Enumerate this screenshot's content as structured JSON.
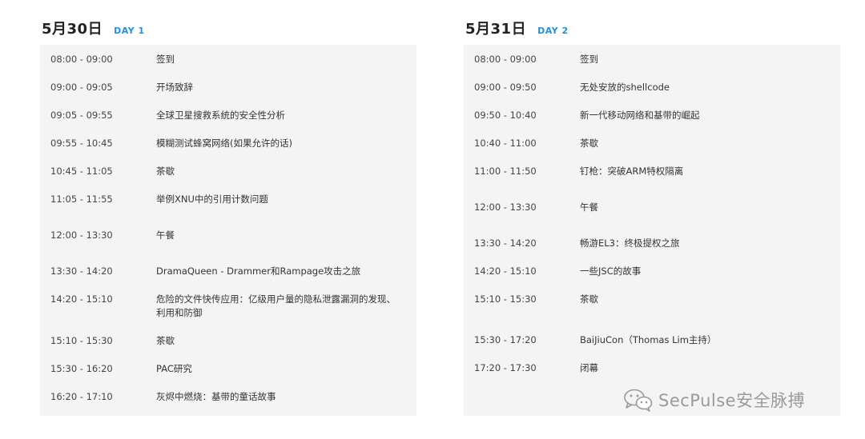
{
  "day1": {
    "date": "5月30日",
    "tag": "DAY 1",
    "rows": [
      {
        "time": "08:00 - 09:00",
        "title": "签到"
      },
      {
        "time": "09:00 - 09:05",
        "title": "开场致辞"
      },
      {
        "time": "09:05 - 09:55",
        "title": "全球卫星搜救系统的安全性分析"
      },
      {
        "time": "09:55 - 10:45",
        "title": "模糊测试蜂窝网络(如果允许的话)"
      },
      {
        "time": "10:45 - 11:05",
        "title": "茶歇"
      },
      {
        "time": "11:05 - 11:55",
        "title": "举例XNU中的引用计数问题"
      },
      {
        "time": "12:00 - 13:30",
        "title": "午餐"
      },
      {
        "time": "13:30 - 14:20",
        "title": "DramaQueen - Drammer和Rampage攻击之旅"
      },
      {
        "time": "14:20 - 15:10",
        "title": "危险的文件快传应用：亿级用户量的隐私泄露漏洞的发现、利用和防御"
      },
      {
        "time": "15:10 - 15:30",
        "title": "茶歇"
      },
      {
        "time": "15:30 - 16:20",
        "title": "PAC研究"
      },
      {
        "time": "16:20 - 17:10",
        "title": "灰烬中燃烧：基带的童话故事"
      }
    ]
  },
  "day2": {
    "date": "5月31日",
    "tag": "DAY 2",
    "rows": [
      {
        "time": "08:00 - 09:00",
        "title": "签到"
      },
      {
        "time": "09:00 - 09:50",
        "title": "无处安放的shellcode"
      },
      {
        "time": "09:50 - 10:40",
        "title": "新一代移动网络和基带的崛起"
      },
      {
        "time": "10:40 - 11:00",
        "title": "茶歇"
      },
      {
        "time": "11:00 - 11:50",
        "title": "钉枪：突破ARM特权隔离"
      },
      {
        "time": "12:00 - 13:30",
        "title": "午餐"
      },
      {
        "time": "13:30 - 14:20",
        "title": "畅游EL3：终极提权之旅"
      },
      {
        "time": "14:20 - 15:10",
        "title": "一些JSC的故事"
      },
      {
        "time": "15:10 - 15:30",
        "title": "茶歇"
      },
      {
        "time": "15:30 - 17:20",
        "title": "BaiJiuCon（Thomas Lim主持）"
      },
      {
        "time": "17:20 - 17:30",
        "title": "闭幕"
      }
    ]
  },
  "watermark": {
    "text": "SecPulse安全脉搏",
    "icon": "wechat-icon"
  },
  "colors": {
    "accent": "#1e90e0",
    "panel": "#f4f4f4"
  }
}
